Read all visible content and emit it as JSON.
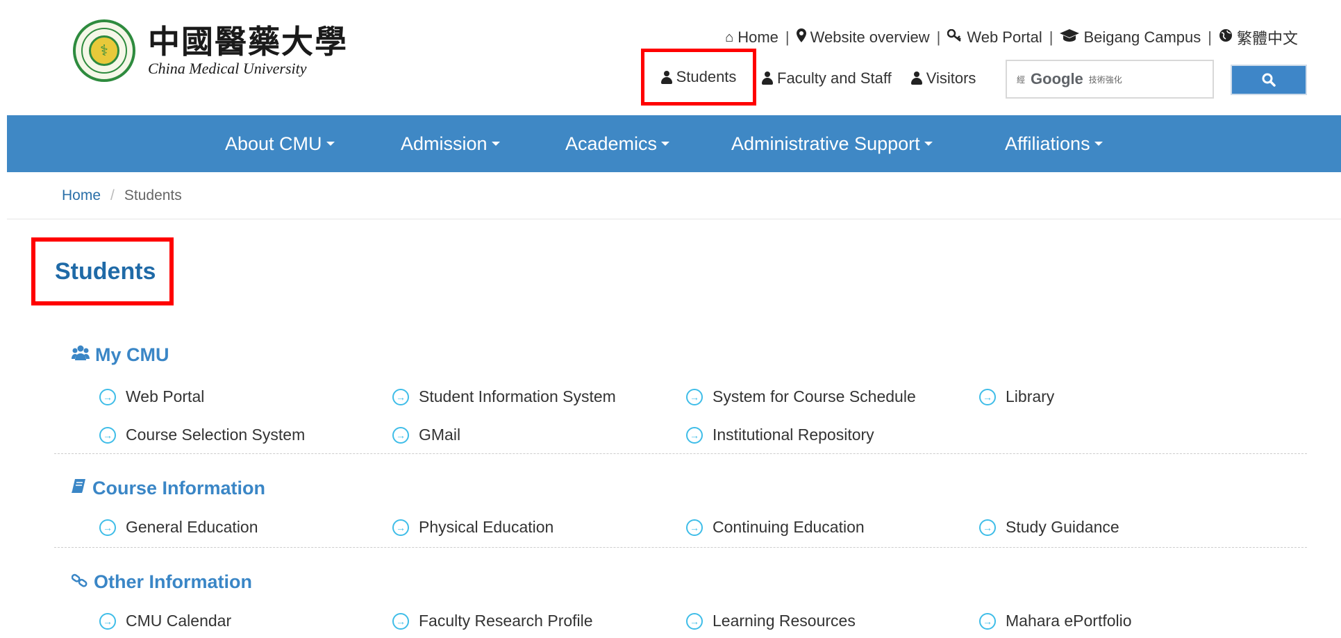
{
  "logo": {
    "chinese_name": "中國醫藥大學",
    "english_name": "China Medical University"
  },
  "toplinks": [
    {
      "label": "Home",
      "icon": "home-icon"
    },
    {
      "label": "Website overview",
      "icon": "map-marker-icon"
    },
    {
      "label": "Web Portal",
      "icon": "key-icon"
    },
    {
      "label": "Beigang Campus",
      "icon": "graduation-cap-icon"
    },
    {
      "label": "繁體中文",
      "icon": "globe-icon"
    }
  ],
  "separator": "|",
  "audience": {
    "students": "Students",
    "faculty": "Faculty and Staff",
    "visitors": "Visitors"
  },
  "search": {
    "brand_prefix": "經",
    "brand": "Google",
    "brand_suffix": "技術強化",
    "button_icon": "search-icon"
  },
  "nav": [
    {
      "label": "About CMU"
    },
    {
      "label": "Admission"
    },
    {
      "label": "Academics"
    },
    {
      "label": "Administrative Support"
    },
    {
      "label": "Affiliations"
    }
  ],
  "breadcrumb": {
    "home": "Home",
    "separator": "/",
    "current": "Students"
  },
  "page_title": "Students",
  "sections": [
    {
      "heading": "My CMU",
      "icon": "users-icon",
      "links": [
        "Web Portal",
        "Student Information System",
        "System for Course Schedule",
        "Library",
        "Course Selection System",
        "GMail",
        "Institutional Repository"
      ]
    },
    {
      "heading": "Course Information",
      "icon": "book-icon",
      "links": [
        "General Education",
        "Physical Education",
        "Continuing Education",
        "Study Guidance"
      ]
    },
    {
      "heading": "Other Information",
      "icon": "link-icon",
      "links": [
        "CMU Calendar",
        "Faculty Research Profile",
        "Learning Resources",
        "Mahara ePortfolio"
      ]
    }
  ],
  "colors": {
    "nav_bg": "#3f88c5",
    "heading_blue": "#3a86c6",
    "title_blue": "#1f6aa7",
    "highlight_red": "#ff0000",
    "arrow_cyan": "#3fbde8"
  }
}
